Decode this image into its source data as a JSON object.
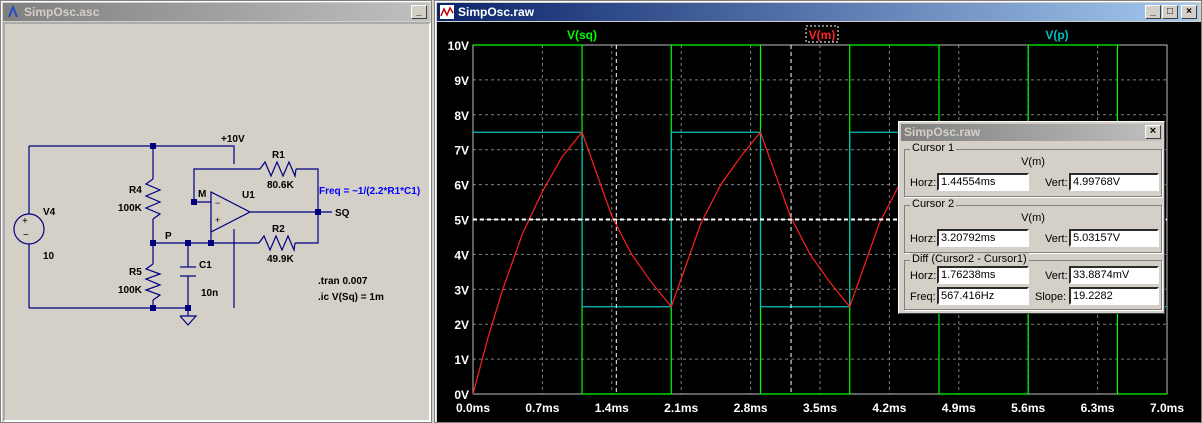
{
  "schematic_window": {
    "title": "SimpOsc.asc",
    "labels": {
      "supply": "+10V",
      "r1": "R1",
      "r1_val": "80.6K",
      "r2": "R2",
      "r2_val": "49.9K",
      "r4": "R4",
      "r4_val": "100K",
      "r5": "R5",
      "r5_val": "100K",
      "c1": "C1",
      "c1_val": "10n",
      "v4": "V4",
      "v4_val": "10",
      "u1": "U1",
      "node_m": "M",
      "node_p": "P",
      "node_sq": "SQ",
      "freq": "Freq = ~1/(2.2*R1*C1)",
      "tran": ".tran 0.007",
      "ic": ".ic V(Sq) = 1m"
    }
  },
  "waveform_window": {
    "title": "SimpOsc.raw",
    "traces": [
      {
        "name": "V(sq)",
        "color": "#00ff00"
      },
      {
        "name": "V(m)",
        "color": "#ff2020"
      },
      {
        "name": "V(p)",
        "color": "#00c0c0"
      }
    ]
  },
  "chart_data": {
    "type": "line",
    "xlabel": "",
    "ylabel": "",
    "xlim": [
      0,
      7.0
    ],
    "ylim": [
      0,
      10
    ],
    "x_ticks": [
      "0.0ms",
      "0.7ms",
      "1.4ms",
      "2.1ms",
      "2.8ms",
      "3.5ms",
      "4.2ms",
      "4.9ms",
      "5.6ms",
      "6.3ms",
      "7.0ms"
    ],
    "y_ticks": [
      "0V",
      "1V",
      "2V",
      "3V",
      "4V",
      "5V",
      "6V",
      "7V",
      "8V",
      "9V",
      "10V"
    ],
    "grid": true,
    "series": [
      {
        "name": "V(sq)",
        "color": "#00ff00",
        "x": [
          0,
          1.1,
          1.1,
          2.0,
          2.0,
          2.9,
          2.9,
          3.8,
          3.8,
          4.7,
          4.7,
          5.6,
          5.6,
          6.5,
          6.5,
          7.0
        ],
        "y": [
          10,
          10,
          0,
          0,
          10,
          10,
          0,
          0,
          10,
          10,
          0,
          0,
          10,
          10,
          0,
          0
        ]
      },
      {
        "name": "V(p)",
        "color": "#00c0c0",
        "x": [
          0,
          1.1,
          1.1,
          2.0,
          2.0,
          2.9,
          2.9,
          3.8,
          3.8,
          4.7,
          4.7,
          5.6,
          5.6,
          6.5,
          6.5,
          7.0
        ],
        "y": [
          7.5,
          7.5,
          2.5,
          2.5,
          7.5,
          7.5,
          2.5,
          2.5,
          7.5,
          7.5,
          2.5,
          2.5,
          7.5,
          7.5,
          2.5,
          2.5
        ]
      },
      {
        "name": "V(m)",
        "color": "#ff2020",
        "x": [
          0,
          0.15,
          0.3,
          0.5,
          0.7,
          0.9,
          1.1,
          1.25,
          1.4,
          1.6,
          1.8,
          2.0,
          2.15,
          2.3,
          2.5,
          2.7,
          2.9,
          3.05,
          3.2,
          3.4,
          3.6,
          3.8,
          3.95,
          4.1,
          4.3
        ],
        "y": [
          0,
          1.6,
          3.0,
          4.6,
          5.8,
          6.8,
          7.5,
          6.3,
          5.1,
          4.0,
          3.2,
          2.5,
          3.7,
          4.9,
          6.0,
          6.8,
          7.5,
          6.3,
          5.1,
          4.0,
          3.2,
          2.5,
          3.7,
          4.9,
          6.0
        ]
      }
    ],
    "cursor_level": 5
  },
  "cursor_dialog": {
    "title": "SimpOsc.raw",
    "close": "×",
    "cursor1": {
      "label": "Cursor 1",
      "trace": "V(m)",
      "horz_label": "Horz:",
      "horz": "1.44554ms",
      "vert_label": "Vert:",
      "vert": "4.99768V"
    },
    "cursor2": {
      "label": "Cursor 2",
      "trace": "V(m)",
      "horz_label": "Horz:",
      "horz": "3.20792ms",
      "vert_label": "Vert:",
      "vert": "5.03157V"
    },
    "diff": {
      "label": "Diff (Cursor2 - Cursor1)",
      "horz_label": "Horz:",
      "horz": "1.76238ms",
      "vert_label": "Vert:",
      "vert": "33.8874mV",
      "freq_label": "Freq:",
      "freq": "567.416Hz",
      "slope_label": "Slope:",
      "slope": "19.2282"
    }
  }
}
